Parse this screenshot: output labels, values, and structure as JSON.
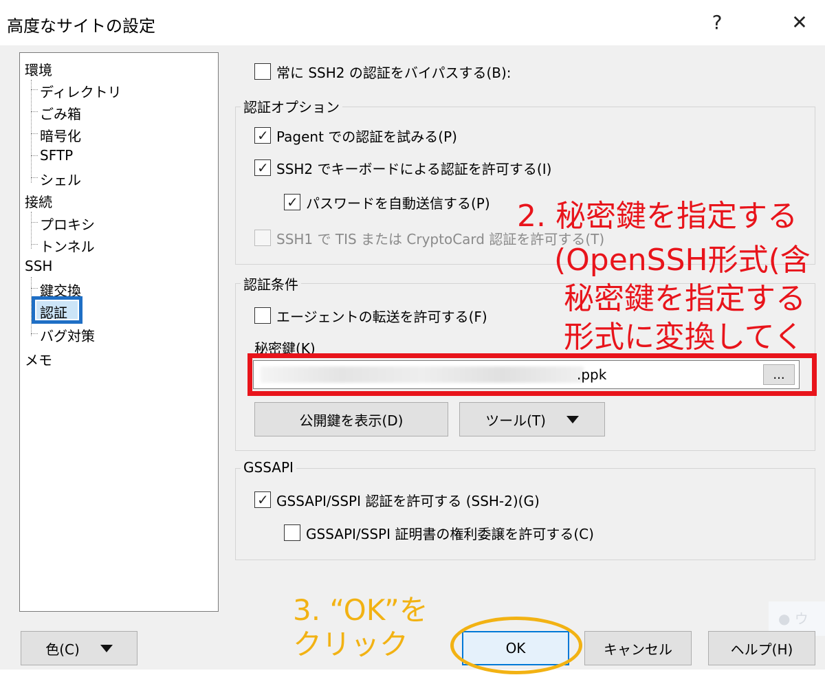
{
  "window": {
    "title": "高度なサイトの設定",
    "help_glyph": "?",
    "close_glyph": "✕"
  },
  "tree": {
    "items": [
      "環境",
      "ディレクトリ",
      "ごみ箱",
      "暗号化",
      "SFTP",
      "シェル",
      "接続",
      "プロキシ",
      "トンネル",
      "SSH",
      "鍵交換",
      "認証",
      "バグ対策",
      "メモ"
    ],
    "selected": "認証"
  },
  "auth": {
    "bypass_label": "常に SSH2 の認証をバイパスする(B):",
    "bypass_checked": false,
    "options_group": "認証オプション",
    "pagent_label": "Pagent での認証を試みる(P)",
    "keyboard_label": "SSH2 でキーボードによる認証を許可する(I)",
    "autopass_label": "パスワードを自動送信する(P)",
    "tis_label": "SSH1 で TIS または CryptoCard 認証を許可する(T)",
    "conditions_group": "認証条件",
    "agent_fwd_label": "エージェントの転送を許可する(F)",
    "private_key_label": "秘密鍵(K)",
    "private_key_value": ".ppk",
    "browse_label": "...",
    "show_pubkey_label": "公開鍵を表示(D)",
    "tools_label": "ツール(T)"
  },
  "gssapi": {
    "group": "GSSAPI",
    "allow_label": "GSSAPI/SSPI 認証を許可する (SSH-2)(G)",
    "delegate_label": "GSSAPI/SSPI 証明書の権利委譲を許可する(C)"
  },
  "footer": {
    "color_label": "色(C)",
    "ok_label": "OK",
    "cancel_label": "キャンセル",
    "help_label": "ヘルプ(H)"
  },
  "annotations": {
    "step2_line1": "2. 秘密鍵を指定する",
    "step2_line2": "(OpenSSH形式(含",
    "step2_line3": "秘密鍵を指定する",
    "step2_line4": "形式に変換してく",
    "step3_line1": "3. “OK”を",
    "step3_line2": "クリック",
    "watermark_text": "● ウ"
  },
  "colors": {
    "annotation_red": "#e8141b",
    "annotation_orange": "#f2b213",
    "selection_blue": "#1f6fc5"
  }
}
